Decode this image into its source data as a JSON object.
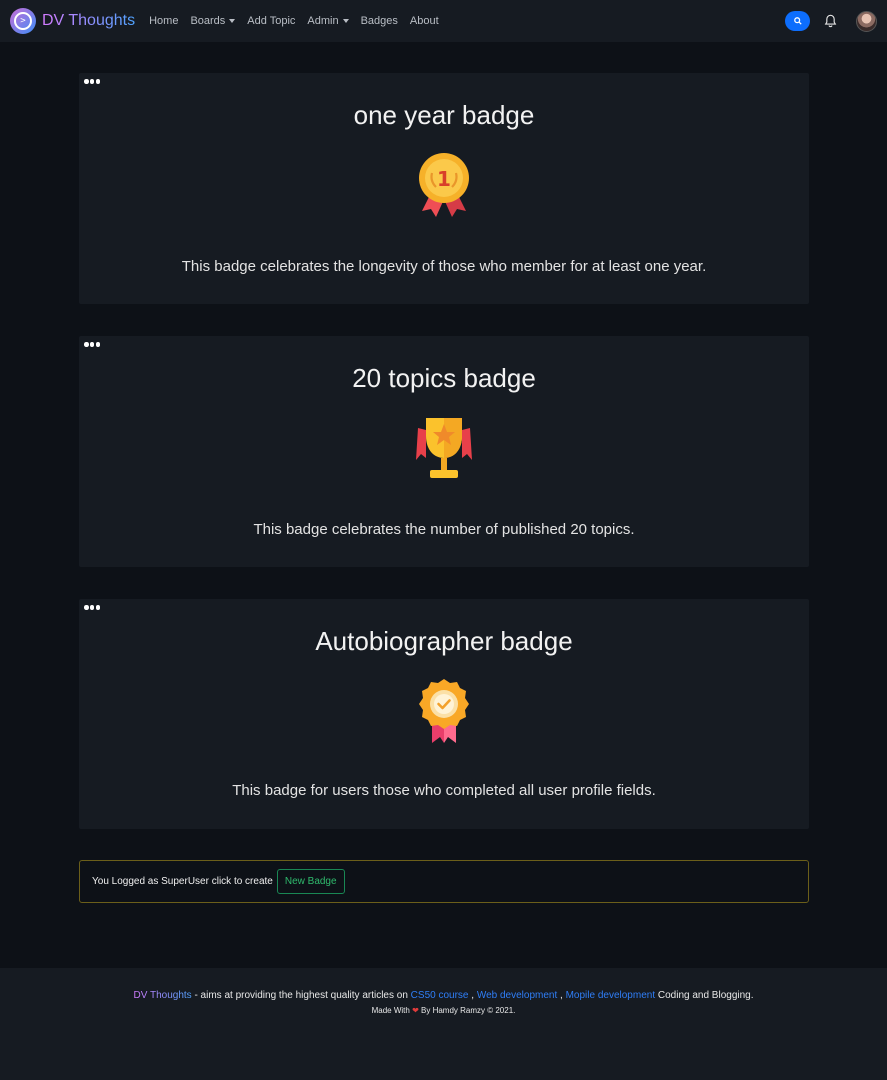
{
  "nav": {
    "brand": "DV Thoughts",
    "links": [
      {
        "label": "Home"
      },
      {
        "label": "Boards"
      },
      {
        "label": "Add Topic"
      },
      {
        "label": "Admin"
      },
      {
        "label": "Badges"
      },
      {
        "label": "About"
      }
    ]
  },
  "badges": [
    {
      "title": "one year badge",
      "icon": "first-place-medal-icon",
      "description": "This badge celebrates the longevity of those who member for at least one year."
    },
    {
      "title": "20 topics badge",
      "icon": "trophy-icon",
      "description": "This badge celebrates the number of published 20 topics."
    },
    {
      "title": "Autobiographer badge",
      "icon": "check-rosette-icon",
      "description": "This badge for users those who completed all user profile fields."
    }
  ],
  "admin": {
    "text": "You Logged as SuperUser click to create",
    "button_label": "New Badge"
  },
  "footer": {
    "brand": "DV Thoughts",
    "text_before": " - aims at providing the highest quality articles on ",
    "link1": "CS50 course",
    "sep1": " , ",
    "link2": "Web development",
    "sep2": " , ",
    "link3": "Mopile development",
    "text_after": " Coding and Blogging.",
    "made_with": "Made With",
    "credit": " By Hamdy Ramzy © 2021."
  },
  "colors": {
    "page_bg": "#0d1117",
    "card_bg": "#161b22",
    "primary": "#0d6efd",
    "success": "#198754",
    "warning_border": "#6b5f1a"
  }
}
